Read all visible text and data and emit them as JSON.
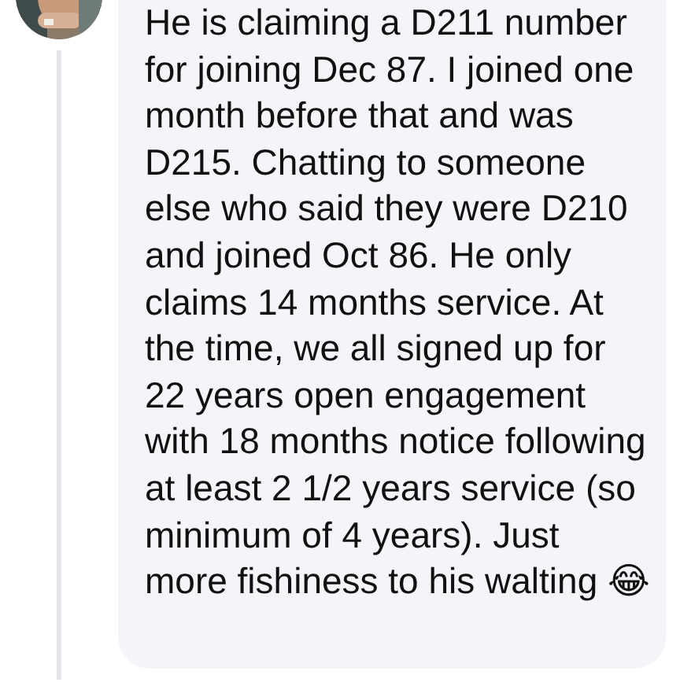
{
  "message": {
    "text": "He is claiming a D211 number for joining Dec 87. I joined one month before that and was D215. Chatting to someone else who said they were D210 and joined Oct 86. He only claims 14 months service. At the time, we all signed up for 22 years open engagement with 18 months notice following at least 2 1/2 years service (so minimum of 4 years). Just more fishiness to his walting 😂"
  }
}
